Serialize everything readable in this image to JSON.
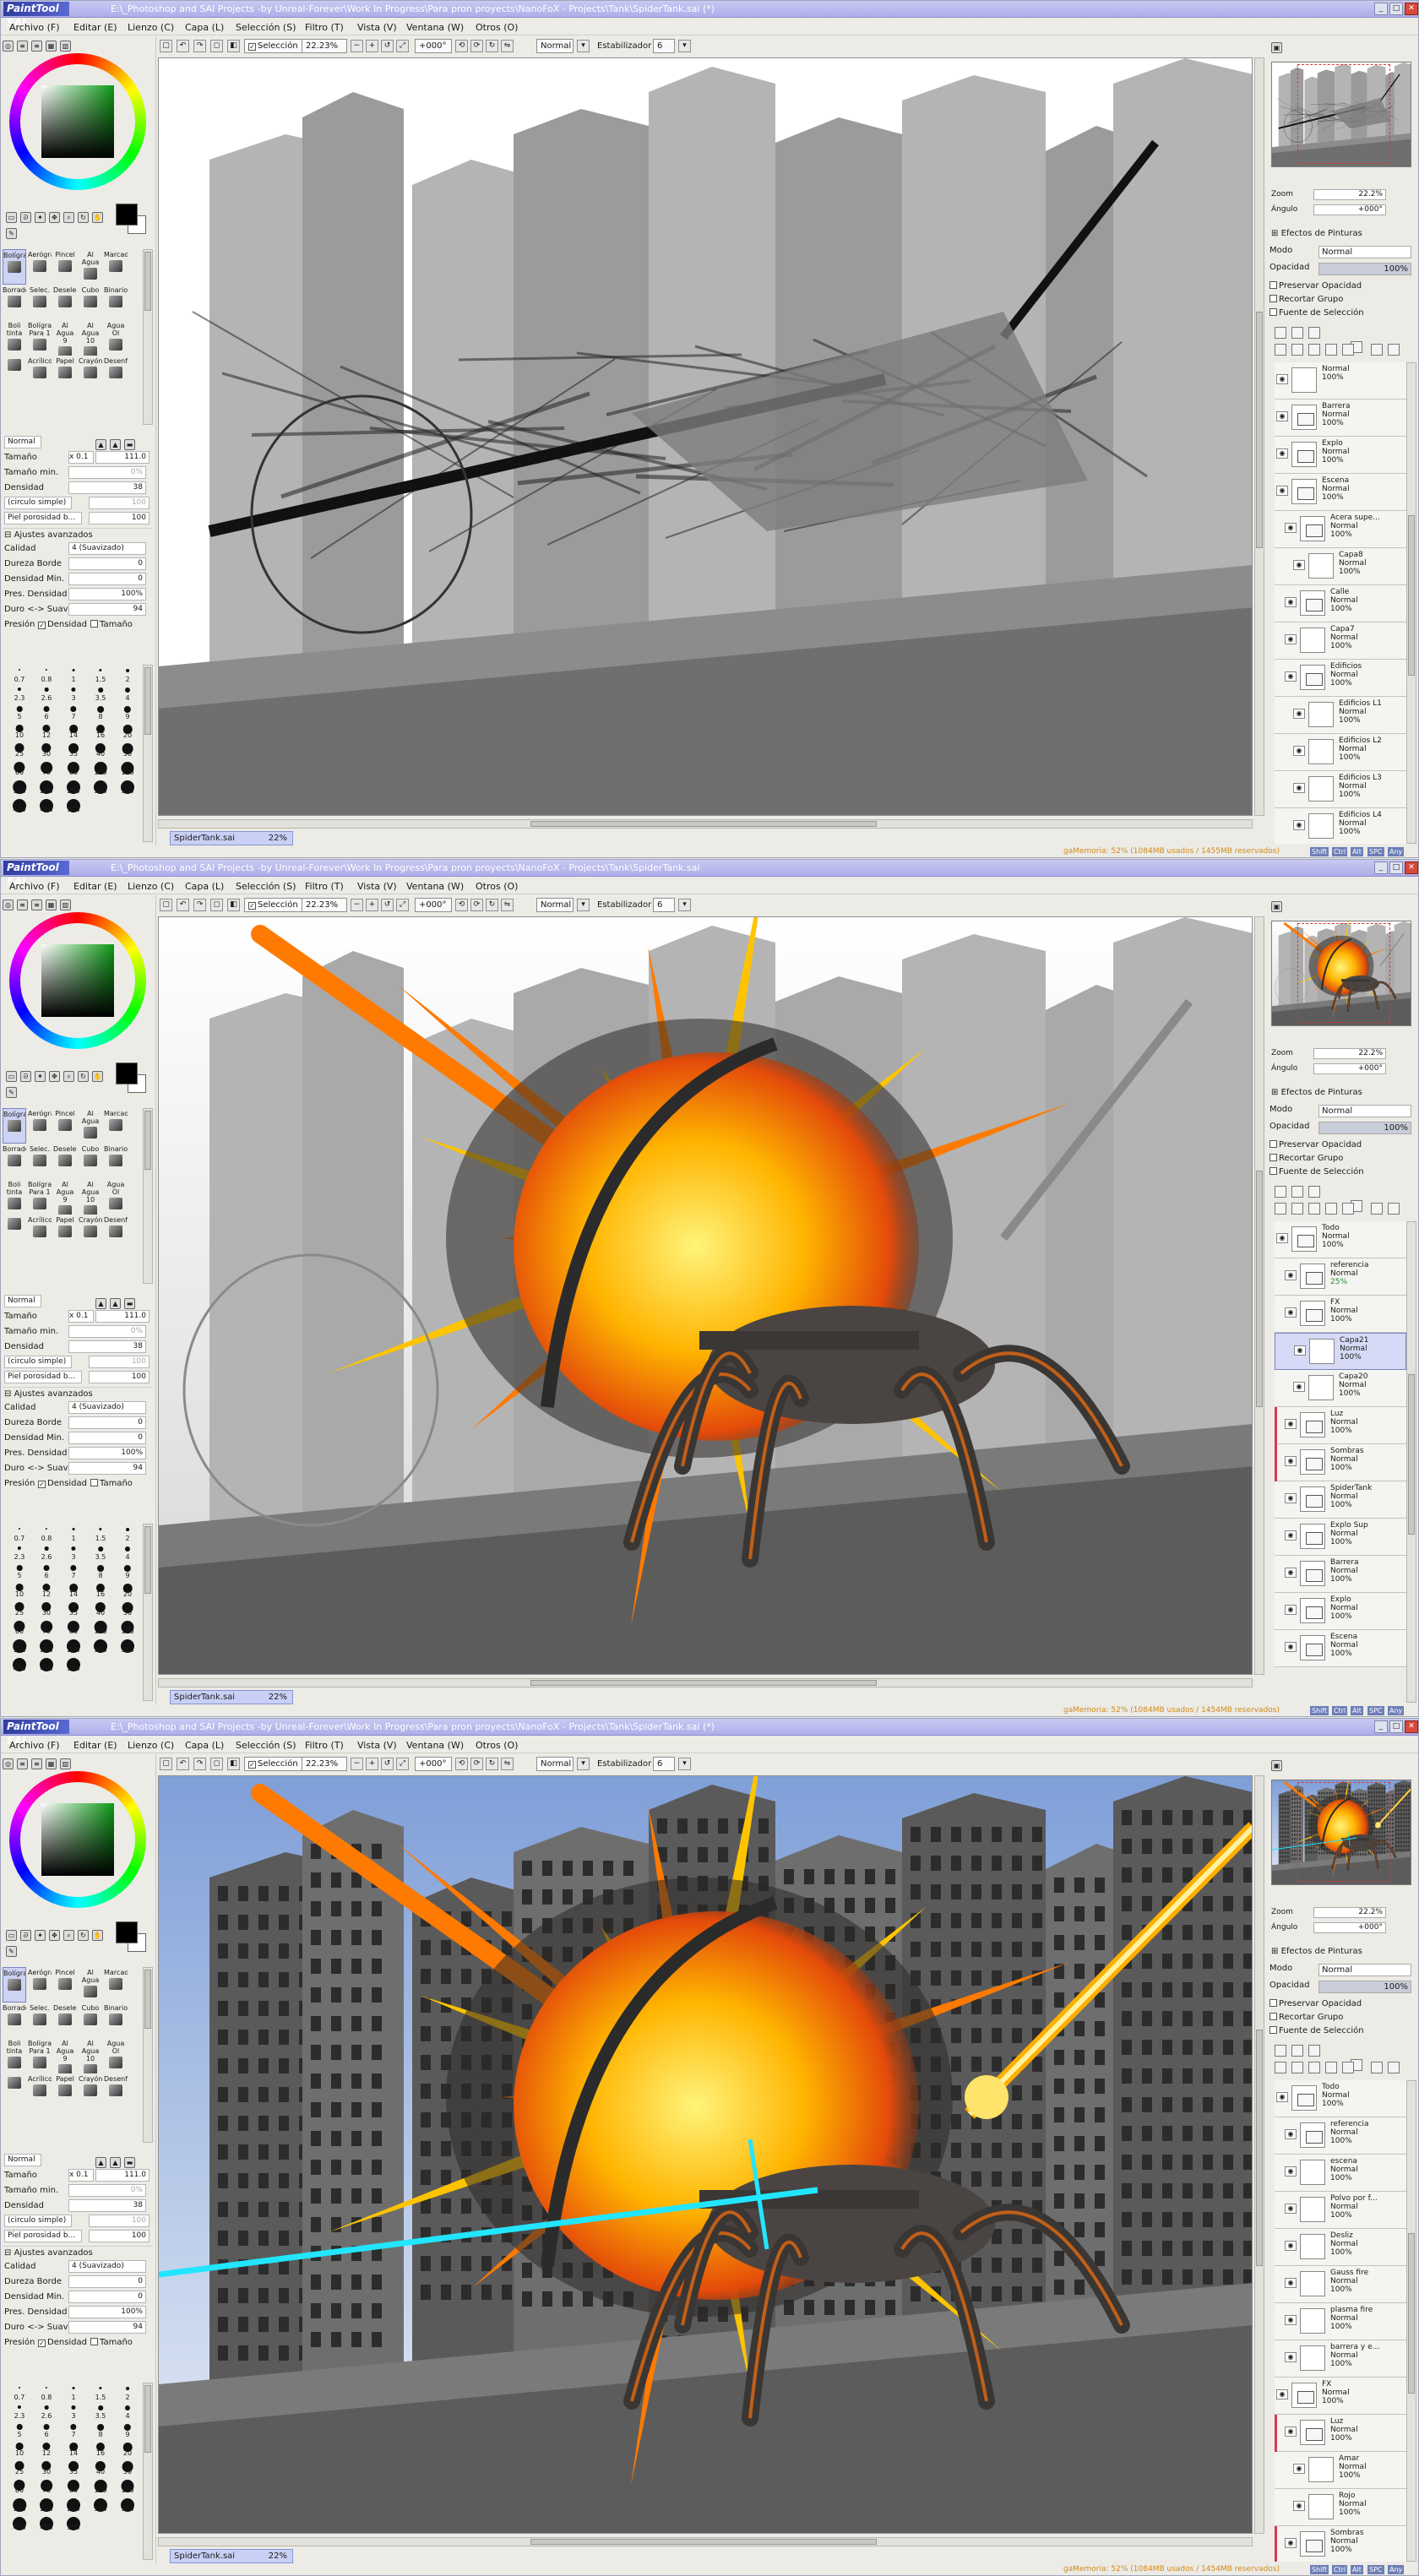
{
  "app": {
    "logo": "PaintTool SAI",
    "title": "E:\\_Photoshop and SAI Projects -by Unreal-Forever\\Work In Progress\\Para pron proyects\\NanoFoX - Projects\\Tank\\SpiderTank.sai (*)"
  },
  "windows_titles": [
    "E:\\_Photoshop and SAI Projects -by Unreal-Forever\\Work In Progress\\Para pron proyects\\NanoFoX - Projects\\Tank\\SpiderTank.sai (*)",
    "E:\\_Photoshop and SAI Projects -by Unreal-Forever\\Work In Progress\\Para pron proyects\\NanoFoX - Projects\\Tank\\SpiderTank.sai",
    "E:\\_Photoshop and SAI Projects -by Unreal-Forever\\Work In Progress\\Para pron proyects\\NanoFoX - Projects\\Tank\\SpiderTank.sai (*)"
  ],
  "menu": [
    "Archivo (F)",
    "Editar (E)",
    "Lienzo (C)",
    "Capa (L)",
    "Selección (S)",
    "Filtro (T)",
    "Vista (V)",
    "Ventana (W)",
    "Otros (O)"
  ],
  "toolbar": {
    "selection_label": "Selección",
    "zoom": "22.23%",
    "angle": "+000°",
    "blend": "Normal",
    "stabilizer_label": "Estabilizador",
    "stabilizer_value": "6"
  },
  "tools": [
    "Bolígrafo",
    "Aerógrafo",
    "Pincel",
    "Al Agua",
    "Marcador",
    "Borrador",
    "Selec.",
    "Deselec.",
    "Cubo",
    "Binario",
    "Boli tinta",
    "Bolígrafo Para 1",
    "Al Agua 9",
    "Al Agua 10",
    "Agua Ol",
    "",
    "Acrílico",
    "Papel",
    "Crayón",
    "Desenf."
  ],
  "brush": {
    "mode": "Normal",
    "size_label": "Tamaño",
    "size_mult": "x 0.1",
    "size_value": "111.0",
    "min_size_label": "Tamaño min.",
    "min_size_value": "0%",
    "density_label": "Densidad",
    "density_value": "38",
    "shape": "(circulo simple)",
    "texture": "Piel porosidad b...",
    "texture_value": "100",
    "advanced_label": "Ajustes avanzados",
    "quality_label": "Calidad",
    "quality_value": "4 (Suavizado)",
    "edge_label": "Dureza Borde",
    "edge_value": "0",
    "min_density_label": "Densidad Min.",
    "min_density_value": "0",
    "pres_label": "Pres. Densidad",
    "pres_value": "100%",
    "hard_label": "Duro <-> Suave",
    "hard_value": "94",
    "pressure_label": "Presión",
    "pressure_density": "Densidad",
    "pressure_size": "Tamaño"
  },
  "brush_sizes": [
    "0.7",
    "0.8",
    "1",
    "1.5",
    "2",
    "2.3",
    "2.6",
    "3",
    "3.5",
    "4",
    "5",
    "6",
    "7",
    "8",
    "9",
    "10",
    "12",
    "14",
    "16",
    "20",
    "25",
    "30",
    "35",
    "40",
    "50",
    "60",
    "70",
    "80",
    "100",
    "120",
    "160",
    "200",
    "250",
    "300",
    "350",
    "400",
    "450",
    "500"
  ],
  "document": {
    "name": "SpiderTank.sai",
    "zoom": "22%"
  },
  "status": {
    "memory_windows": [
      "gaMemoria: 52% (1084MB usados / 1455MB reservados)",
      "gaMemoria: 52% (1084MB usados / 1454MB reservados)",
      "gaMemoria: 52% (1084MB usados / 1454MB reservados)"
    ],
    "indicators": [
      "Shift",
      "Ctrl",
      "Alt",
      "SPC",
      "Any"
    ]
  },
  "navigator": {
    "zoom_label": "Zoom",
    "zoom_value": "22.2%",
    "angle_label": "Ángulo",
    "angle_value": "+000°"
  },
  "layer_panel": {
    "effects_label": "Efectos de Pinturas",
    "mode_label": "Modo",
    "mode_value": "Normal",
    "opacity_label": "Opacidad",
    "opacity_value": "100%",
    "preserve_label": "Preservar Opacidad",
    "clip_label": "Recortar Grupo",
    "source_label": "Fuente de Selección"
  },
  "layers_w1": [
    {
      "name": "",
      "mode": "Normal",
      "op": "100%",
      "folder": false,
      "indent": 0
    },
    {
      "name": "Barrera",
      "mode": "Normal",
      "op": "100%",
      "folder": true,
      "indent": 0
    },
    {
      "name": "Explo",
      "mode": "Normal",
      "op": "100%",
      "folder": true,
      "indent": 0
    },
    {
      "name": "Escena",
      "mode": "Normal",
      "op": "100%",
      "folder": true,
      "indent": 0
    },
    {
      "name": "Acera supe...",
      "mode": "Normal",
      "op": "100%",
      "folder": true,
      "indent": 1
    },
    {
      "name": "Capa8",
      "mode": "Normal",
      "op": "100%",
      "folder": false,
      "indent": 2
    },
    {
      "name": "Calle",
      "mode": "Normal",
      "op": "100%",
      "folder": true,
      "indent": 1
    },
    {
      "name": "Capa7",
      "mode": "Normal",
      "op": "100%",
      "folder": false,
      "indent": 1
    },
    {
      "name": "Edificios",
      "mode": "Normal",
      "op": "100%",
      "folder": true,
      "indent": 1
    },
    {
      "name": "Edificios L1",
      "mode": "Normal",
      "op": "100%",
      "folder": false,
      "indent": 2
    },
    {
      "name": "Edificios L2",
      "mode": "Normal",
      "op": "100%",
      "folder": false,
      "indent": 2
    },
    {
      "name": "Edificios L3",
      "mode": "Normal",
      "op": "100%",
      "folder": false,
      "indent": 2
    },
    {
      "name": "Edificios L4",
      "mode": "Normal",
      "op": "100%",
      "folder": false,
      "indent": 2
    }
  ],
  "layers_w2": [
    {
      "name": "Todo",
      "mode": "Normal",
      "op": "100%",
      "folder": true,
      "indent": 0
    },
    {
      "name": "referencia",
      "mode": "Normal",
      "op": "25%",
      "folder": true,
      "indent": 1
    },
    {
      "name": "FX",
      "mode": "Normal",
      "op": "100%",
      "folder": true,
      "indent": 1
    },
    {
      "name": "Capa21",
      "mode": "Normal",
      "op": "100%",
      "folder": false,
      "indent": 2,
      "sel": true
    },
    {
      "name": "Capa20",
      "mode": "Normal",
      "op": "100%",
      "folder": false,
      "indent": 2
    },
    {
      "name": "Luz",
      "mode": "Normal",
      "op": "100%",
      "folder": true,
      "indent": 1,
      "mark": true
    },
    {
      "name": "Sombras",
      "mode": "Normal",
      "op": "100%",
      "folder": true,
      "indent": 1,
      "mark": true
    },
    {
      "name": "SpiderTank",
      "mode": "Normal",
      "op": "100%",
      "folder": true,
      "indent": 1
    },
    {
      "name": "Explo Sup",
      "mode": "Normal",
      "op": "100%",
      "folder": true,
      "indent": 1
    },
    {
      "name": "Barrera",
      "mode": "Normal",
      "op": "100%",
      "folder": true,
      "indent": 1
    },
    {
      "name": "Explo",
      "mode": "Normal",
      "op": "100%",
      "folder": true,
      "indent": 1
    },
    {
      "name": "Escena",
      "mode": "Normal",
      "op": "100%",
      "folder": true,
      "indent": 1
    }
  ],
  "layers_w3": [
    {
      "name": "Todo",
      "mode": "Normal",
      "op": "100%",
      "folder": true,
      "indent": 0
    },
    {
      "name": "referencia",
      "mode": "Normal",
      "op": "100%",
      "folder": true,
      "indent": 1
    },
    {
      "name": "escena",
      "mode": "Normal",
      "op": "100%",
      "folder": false,
      "indent": 1
    },
    {
      "name": "Polvo por f...",
      "mode": "Normal",
      "op": "100%",
      "folder": false,
      "indent": 1
    },
    {
      "name": "Desliz",
      "mode": "Normal",
      "op": "100%",
      "folder": false,
      "indent": 1
    },
    {
      "name": "Gauss fire",
      "mode": "Normal",
      "op": "100%",
      "folder": false,
      "indent": 1
    },
    {
      "name": "plasma fire",
      "mode": "Normal",
      "op": "100%",
      "folder": false,
      "indent": 1
    },
    {
      "name": "barrera y e...",
      "mode": "Normal",
      "op": "100%",
      "folder": false,
      "indent": 1
    },
    {
      "name": "FX",
      "mode": "Normal",
      "op": "100%",
      "folder": true,
      "indent": 0
    },
    {
      "name": "Luz",
      "mode": "Normal",
      "op": "100%",
      "folder": true,
      "indent": 1,
      "mark": true
    },
    {
      "name": "Amar",
      "mode": "Normal",
      "op": "100%",
      "folder": false,
      "indent": 2
    },
    {
      "name": "Rojo",
      "mode": "Normal",
      "op": "100%",
      "folder": false,
      "indent": 2
    },
    {
      "name": "Sombras",
      "mode": "Normal",
      "op": "100%",
      "folder": true,
      "indent": 1,
      "mark": true
    }
  ],
  "colors": {
    "titlebar": "#aeaee9",
    "accent": "#7883c2",
    "fire": "#ff8a00",
    "laser": "#22e6ff"
  }
}
